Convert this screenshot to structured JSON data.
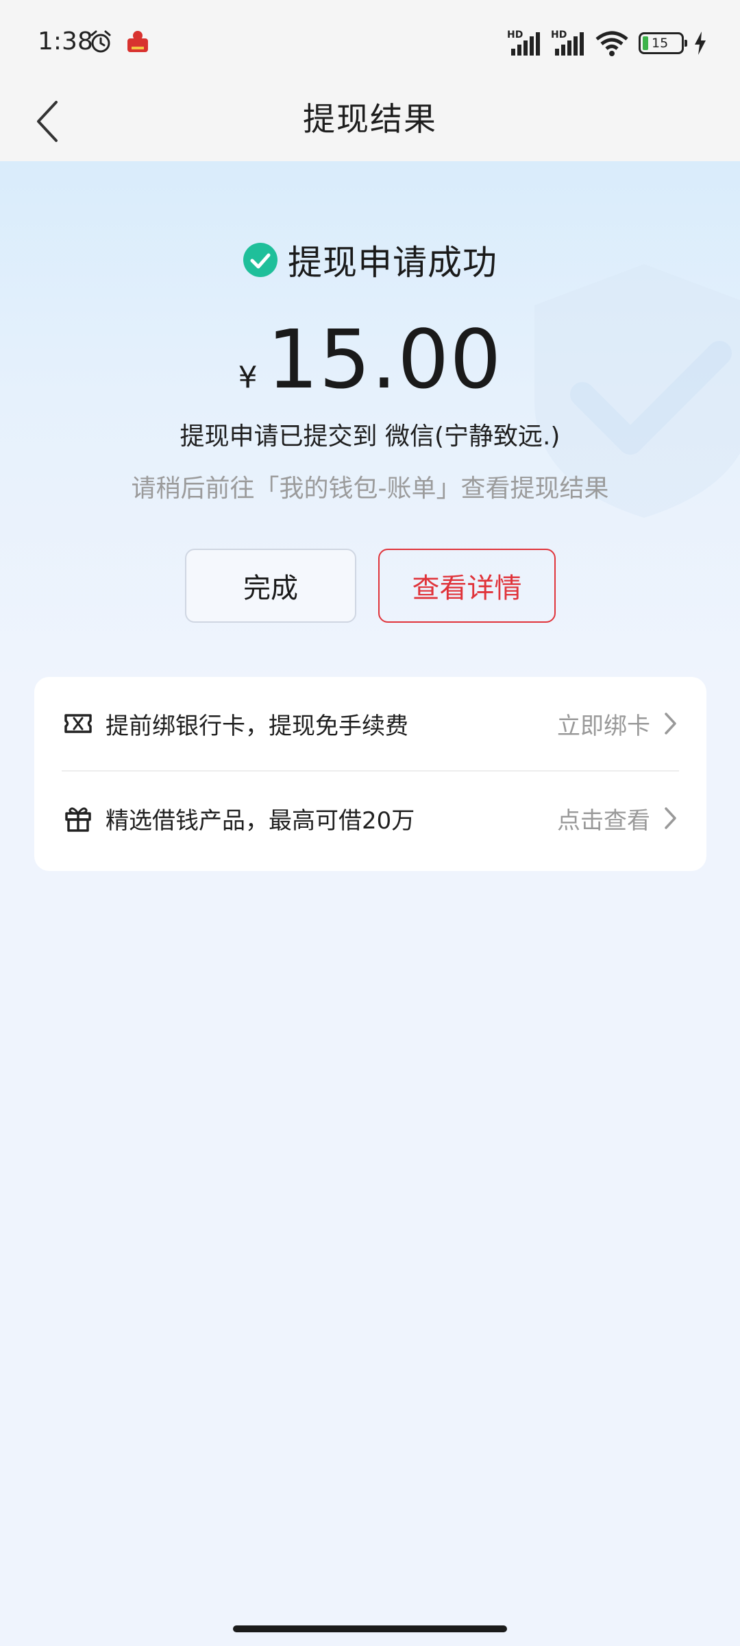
{
  "status_bar": {
    "time": "1:38",
    "battery_level": "15",
    "signal_label": "HD",
    "icons": [
      "alarm-icon",
      "app-notification-icon",
      "signal-icon",
      "signal-icon",
      "wifi-icon",
      "battery-icon",
      "charging-icon"
    ]
  },
  "nav": {
    "title": "提现结果",
    "back_icon": "chevron-left-icon"
  },
  "result": {
    "status_text": "提现申请成功",
    "currency_symbol": "¥",
    "amount": "15.00",
    "submitted_text": "提现申请已提交到 微信(宁静致远.)",
    "hint_text": "请稍后前往「我的钱包-账单」查看提现结果",
    "success_color": "#1fbf9a"
  },
  "buttons": {
    "done_label": "完成",
    "detail_label": "查看详情",
    "accent_color": "#e0333a"
  },
  "promos": [
    {
      "icon": "ticket-icon",
      "label": "提前绑银行卡，提现免手续费",
      "action": "立即绑卡"
    },
    {
      "icon": "gift-icon",
      "label": "精选借钱产品，最高可借20万",
      "action": "点击查看"
    }
  ]
}
